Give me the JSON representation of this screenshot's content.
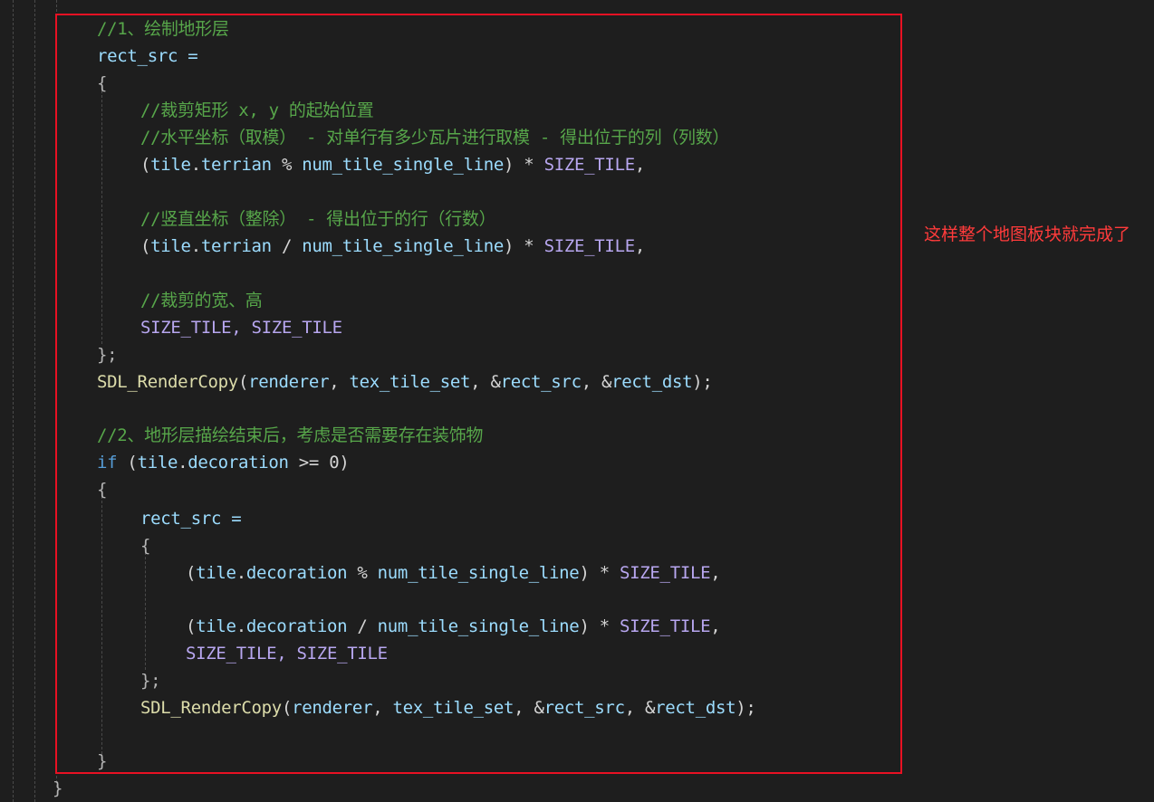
{
  "editor": {
    "lines": [
      "//1、绘制地形层",
      "rect_src =",
      "{",
      "//裁剪矩形 x, y 的起始位置",
      "//水平坐标（取模） - 对单行有多少瓦片进行取模 - 得出位于的列（列数）",
      "(tile.terrian % num_tile_single_line) * SIZE_TILE,",
      "//竖直坐标（整除） - 得出位于的行（行数）",
      "(tile.terrian / num_tile_single_line) * SIZE_TILE,",
      "//裁剪的宽、高",
      "SIZE_TILE, SIZE_TILE",
      "};",
      "SDL_RenderCopy(renderer, tex_tile_set, &rect_src, &rect_dst);",
      "//2、地形层描绘结束后，考虑是否需要存在装饰物",
      "if (tile.decoration >= 0)",
      "{",
      "rect_src =",
      "{",
      "(tile.decoration % num_tile_single_line) * SIZE_TILE,",
      "(tile.decoration / num_tile_single_line) * SIZE_TILE,",
      "SIZE_TILE, SIZE_TILE",
      "};",
      "SDL_RenderCopy(renderer, tex_tile_set, &rect_src, &rect_dst);",
      "}",
      "}"
    ]
  },
  "annotation": {
    "text": "这样整个地图板块就完成了",
    "color": "#ff3b3b"
  },
  "highlight_box": {
    "color": "#e81123"
  },
  "colors": {
    "background": "#1e1e1e",
    "comment": "#57a64a",
    "variable": "#9cdcfe",
    "keyword": "#569cd6",
    "function": "#dcdcaa",
    "macro": "#b8a7f0"
  }
}
